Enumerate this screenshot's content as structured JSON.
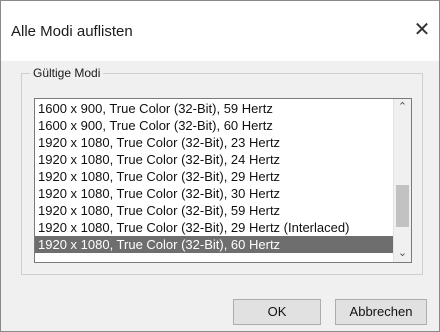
{
  "window": {
    "title": "Alle Modi auflisten",
    "close_glyph": "✕"
  },
  "group": {
    "label": "Gültige Modi"
  },
  "modes": [
    "1600 x 900, True Color (32-Bit), 59 Hertz",
    "1600 x 900, True Color (32-Bit), 60 Hertz",
    "1920 x 1080, True Color (32-Bit), 23 Hertz",
    "1920 x 1080, True Color (32-Bit), 24 Hertz",
    "1920 x 1080, True Color (32-Bit), 29 Hertz",
    "1920 x 1080, True Color (32-Bit), 30 Hertz",
    "1920 x 1080, True Color (32-Bit), 59 Hertz",
    "1920 x 1080, True Color (32-Bit), 29 Hertz (Interlaced)",
    "1920 x 1080, True Color (32-Bit), 60 Hertz"
  ],
  "selected_index": 8,
  "scrollbar": {
    "up_icon": "chevron-up-icon",
    "down_icon": "chevron-down-icon",
    "up_glyph": "⌃",
    "down_glyph": "⌄"
  },
  "buttons": {
    "ok_label": "OK",
    "cancel_label": "Abbrechen"
  },
  "colors": {
    "selection": "#6e6e6e",
    "dialog_bg": "#f0f0f0"
  }
}
